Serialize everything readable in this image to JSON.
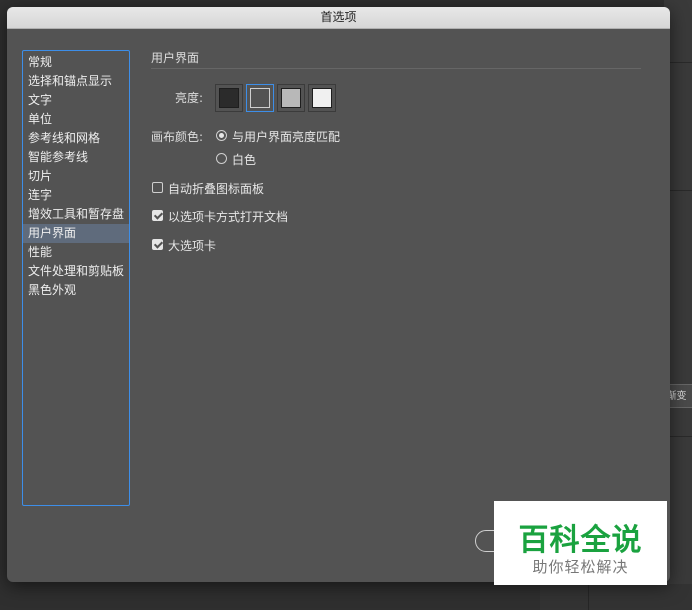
{
  "dialog": {
    "title": "首选项"
  },
  "sidebar": {
    "items": [
      {
        "label": "常规"
      },
      {
        "label": "选择和锚点显示"
      },
      {
        "label": "文字"
      },
      {
        "label": "单位"
      },
      {
        "label": "参考线和网格"
      },
      {
        "label": "智能参考线"
      },
      {
        "label": "切片"
      },
      {
        "label": "连字"
      },
      {
        "label": "增效工具和暂存盘"
      },
      {
        "label": "用户界面",
        "active": true
      },
      {
        "label": "性能"
      },
      {
        "label": "文件处理和剪贴板"
      },
      {
        "label": "黑色外观"
      }
    ]
  },
  "content": {
    "section_title": "用户界面",
    "brightness_label": "亮度:",
    "brightness_swatches": [
      {
        "color": "#2b2b2b",
        "selected": false
      },
      {
        "color": "#535353",
        "selected": true
      },
      {
        "color": "#b8b8b8",
        "selected": false
      },
      {
        "color": "#f0f0f0",
        "selected": false
      }
    ],
    "canvas_label": "画布颜色:",
    "canvas_options": [
      {
        "label": "与用户界面亮度匹配",
        "selected": true
      },
      {
        "label": "白色",
        "selected": false
      }
    ],
    "checkboxes": [
      {
        "label": "自动折叠图标面板",
        "checked": false
      },
      {
        "label": "以选项卡方式打开文档",
        "checked": true
      },
      {
        "label": "大选项卡",
        "checked": true
      }
    ]
  },
  "background": {
    "button_label": "渐变"
  },
  "watermark": {
    "main": "百科全说",
    "sub": "助你轻松解决"
  },
  "colors": {
    "accent": "#3d8ee8",
    "dialog_bg": "#535353",
    "watermark_green": "#1aa23f"
  }
}
